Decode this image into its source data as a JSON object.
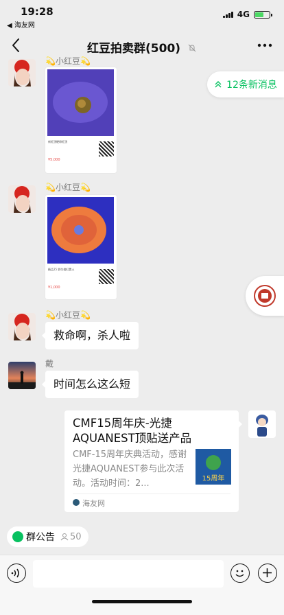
{
  "status_bar": {
    "time": "19:28",
    "back_app": "◀ 海友网",
    "network": "4G"
  },
  "header": {
    "title": "红豆拍卖群(500)",
    "back_icon": "chevron-left-icon",
    "more_icon": "more-dots-icon"
  },
  "new_messages": {
    "label": "12条新消息",
    "icon": "double-chevron-up-icon"
  },
  "messages": [
    {
      "sender": "💫小红豆💫",
      "type": "image-card",
      "card_title": "新紅頂硬帶紅頂",
      "card_price": "¥5,000",
      "photo_colors": [
        "#5b3fbf",
        "#8a6a2f"
      ]
    },
    {
      "sender": "💫小红豆💫",
      "type": "image-card",
      "card_title": "精品25  野生橙紅置土",
      "card_price": "¥1,000",
      "photo_colors": [
        "#2f2fc4",
        "#f07a3c"
      ]
    },
    {
      "sender": "💫小红豆💫",
      "type": "text",
      "text": "救命啊，杀人啦"
    },
    {
      "sender": "戴",
      "type": "text",
      "text": "时间怎么这么短"
    },
    {
      "sender": "self",
      "type": "link",
      "title": "CMF15周年庆-光捷AQUANEST顶贴送产品",
      "description": "CMF-15周年庆典活动，感谢光捷AQUANEST参与此次活动。活动时间：2...",
      "source": "海友网",
      "thumb_text": "15周年"
    }
  ],
  "announcement": {
    "label": "群公告",
    "count": "50"
  },
  "input": {
    "placeholder": ""
  },
  "colors": {
    "accent": "#07c160",
    "background": "#ededed",
    "bubble": "#ffffff"
  }
}
